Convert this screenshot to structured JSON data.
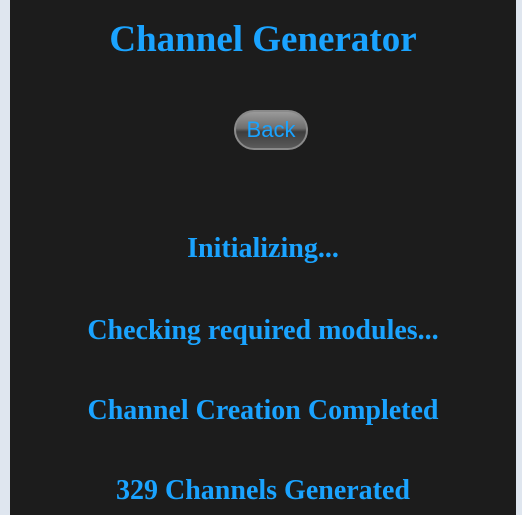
{
  "header": {
    "title": "Channel Generator"
  },
  "controls": {
    "back_label": "Back"
  },
  "status_messages": [
    "Initializing...",
    "Checking required modules...",
    "Channel Creation Completed",
    "329 Channels Generated"
  ],
  "colors": {
    "accent": "#1aa3ff",
    "panel_background": "#1c1c1c",
    "page_background": "#dfe6ef"
  }
}
